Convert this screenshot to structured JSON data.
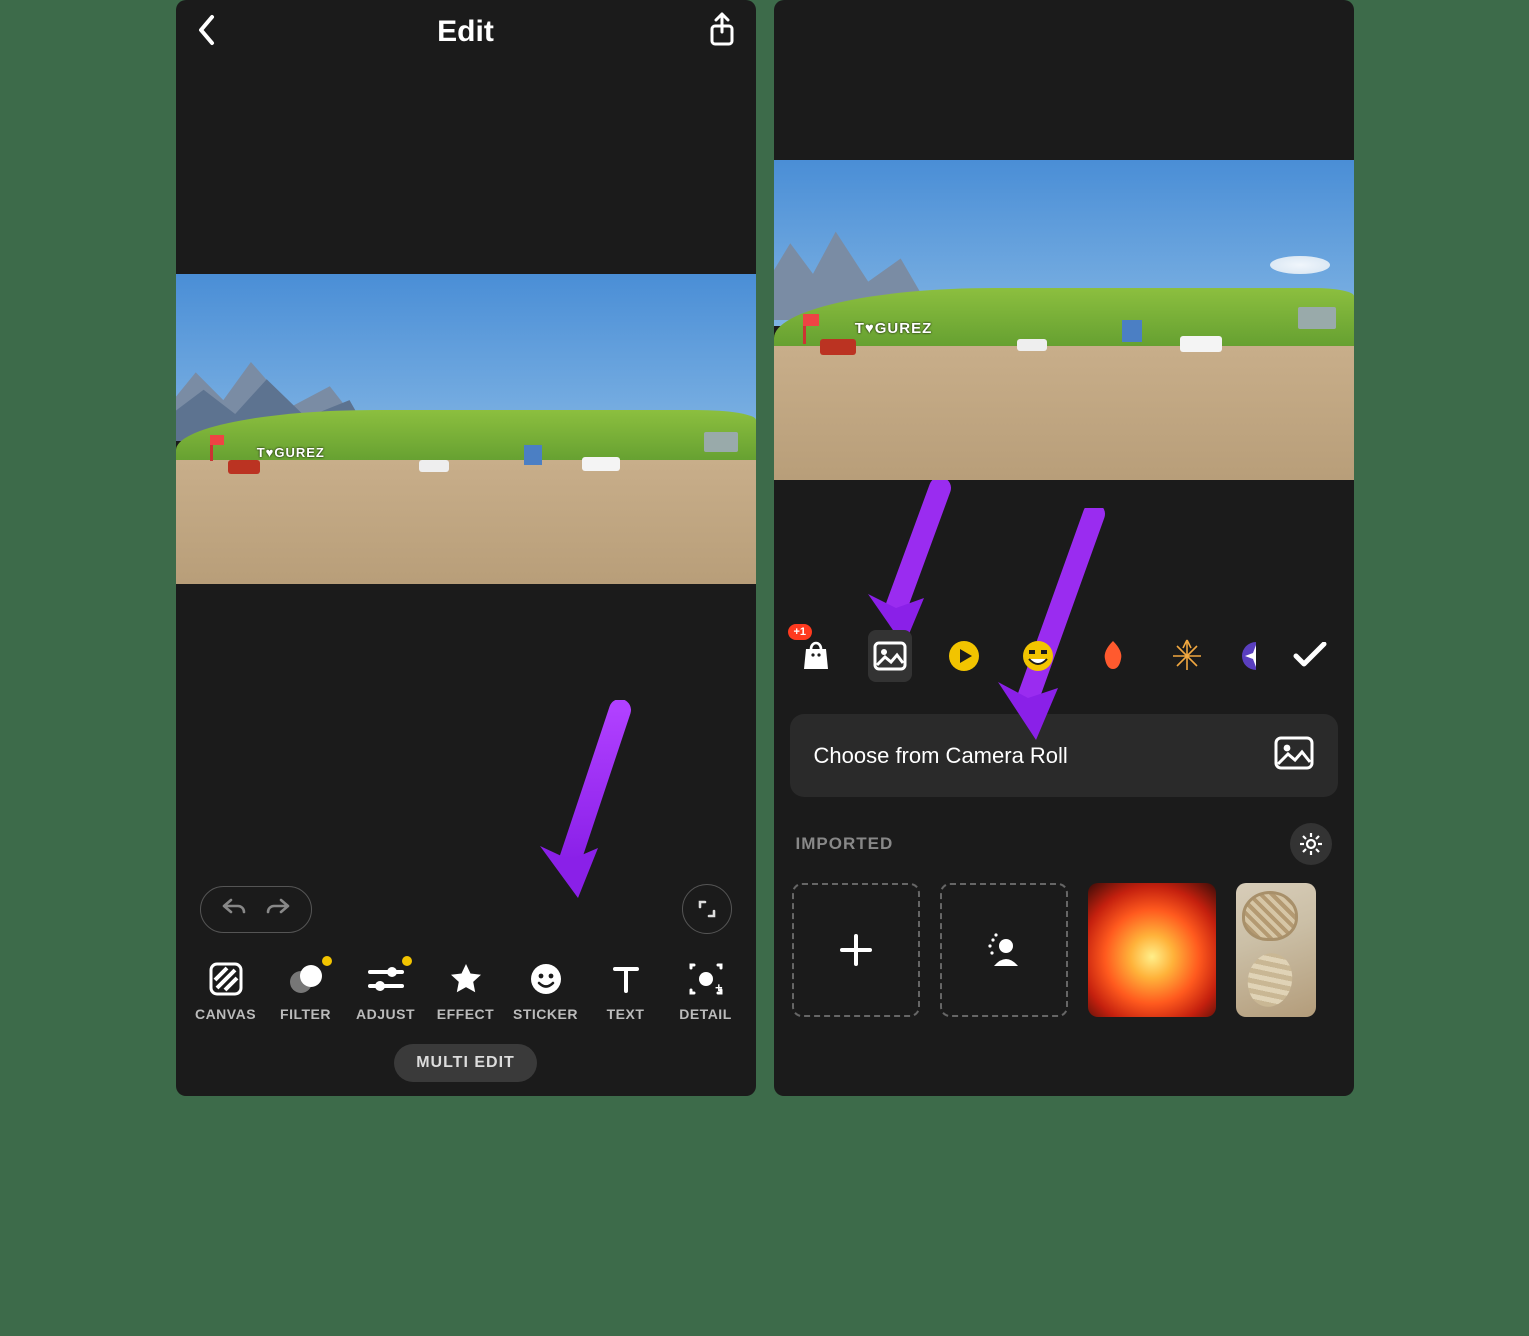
{
  "left": {
    "header": {
      "title": "Edit"
    },
    "tools": [
      {
        "id": "canvas",
        "label": "CANVAS"
      },
      {
        "id": "filter",
        "label": "FILTER",
        "notif": true
      },
      {
        "id": "adjust",
        "label": "ADJUST",
        "notif": true
      },
      {
        "id": "effect",
        "label": "EFFECT"
      },
      {
        "id": "sticker",
        "label": "STICKER"
      },
      {
        "id": "text",
        "label": "TEXT"
      },
      {
        "id": "detail",
        "label": "DETAIL"
      }
    ],
    "multi_edit": "MULTI EDIT"
  },
  "right": {
    "sticker_categories": [
      {
        "id": "shop",
        "badge": "+1"
      },
      {
        "id": "gallery",
        "selected": true
      },
      {
        "id": "play"
      },
      {
        "id": "emoji"
      },
      {
        "id": "flame"
      },
      {
        "id": "firework"
      },
      {
        "id": "sparkle"
      }
    ],
    "choose_label": "Choose from Camera Roll",
    "imported_label": "IMPORTED",
    "thumbs": [
      {
        "id": "add"
      },
      {
        "id": "portrait"
      },
      {
        "id": "lantern"
      },
      {
        "id": "basket"
      }
    ]
  }
}
